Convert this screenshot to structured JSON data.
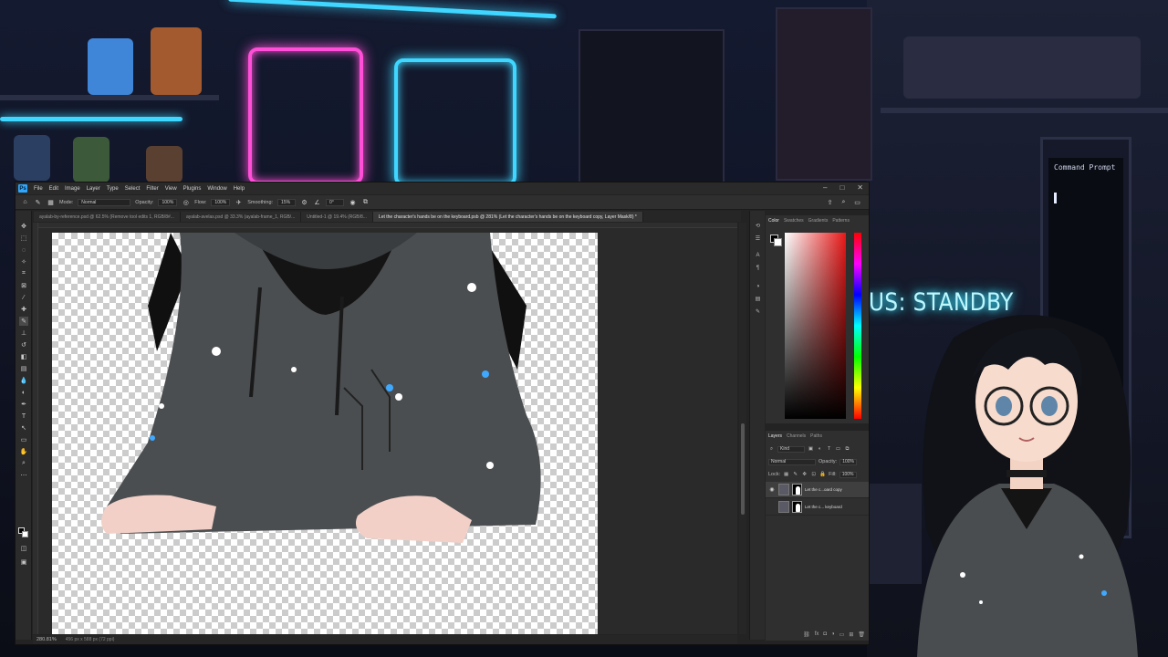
{
  "app": {
    "logo": "Ps",
    "menu": [
      "File",
      "Edit",
      "Image",
      "Layer",
      "Type",
      "Select",
      "Filter",
      "View",
      "Plugins",
      "Window",
      "Help"
    ],
    "window_controls": {
      "minimize": "–",
      "maximize": "□",
      "close": "✕"
    }
  },
  "options_bar": {
    "mode_label": "Mode:",
    "mode_value": "Normal",
    "opacity_label": "Opacity:",
    "opacity_value": "100%",
    "flow_label": "Flow:",
    "flow_value": "100%",
    "smoothing_label": "Smoothing:",
    "smoothing_value": "15%",
    "angle_value": "0°"
  },
  "tabs": [
    {
      "label": "ayalab-by-reference.psd @ 62.5% (Remove tool edits 1, RGB/8#..."
    },
    {
      "label": "ayalab-avelas.psd @ 33.3% (ayalab-frame_1, RGB/..."
    },
    {
      "label": "Untitled-1 @ 19.4% (RGB/8..."
    },
    {
      "label": "Let the character's hands be on the keyboard.psb @ 281% (Let the character's hands be on the keyboard copy, Layer Mask/8) *"
    }
  ],
  "status_bar": {
    "zoom": "280.81%",
    "doc_info": "456 px x 588 px (72 ppi)"
  },
  "color_panel": {
    "tabs": [
      "Color",
      "Swatches",
      "Gradients",
      "Patterns"
    ],
    "foreground": "#000000",
    "background": "#ffffff",
    "hue": "#e81818"
  },
  "layers_panel": {
    "tabs": [
      "Layers",
      "Channels",
      "Paths"
    ],
    "filter_label": "Kind",
    "blend_mode": "Normal",
    "opacity_label": "Opacity:",
    "opacity_value": "100%",
    "lock_label": "Lock:",
    "fill_label": "Fill:",
    "fill_value": "100%",
    "layers": [
      {
        "name": "Let the c...oard copy",
        "visible": true,
        "selected": true
      },
      {
        "name": "Let the c... keyboard",
        "visible": false,
        "selected": false
      }
    ]
  },
  "stream_overlay": {
    "status": "US: STANDBY",
    "monitor_caption": "Command Prompt"
  },
  "colors": {
    "accent_pink": "#ff4fd8",
    "accent_cyan": "#3fd6ff",
    "ps_blue": "#31a8ff"
  }
}
